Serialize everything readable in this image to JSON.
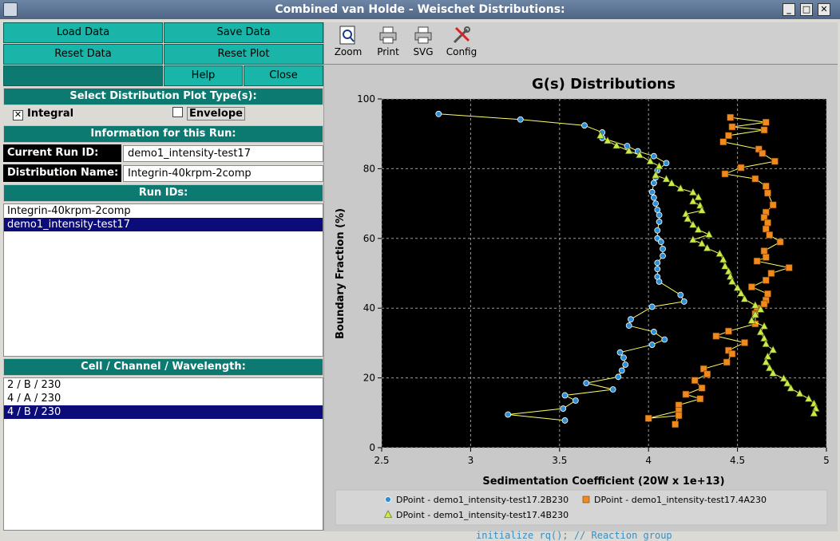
{
  "window": {
    "title": "Combined van Holde - Weischet Distributions:"
  },
  "buttons": {
    "load_data": "Load Data",
    "save_data": "Save Data",
    "reset_data": "Reset Data",
    "reset_plot": "Reset Plot",
    "help": "Help",
    "close": "Close"
  },
  "plot_type": {
    "heading": "Select Distribution Plot Type(s):",
    "integral_label": "Integral",
    "integral_checked": true,
    "envelope_label": "Envelope",
    "envelope_checked": false
  },
  "run_info": {
    "heading": "Information for this Run:",
    "current_run_label": "Current Run ID:",
    "current_run_value": "demo1_intensity-test17",
    "dist_name_label": "Distribution Name:",
    "dist_name_value": "Integrin-40krpm-2comp"
  },
  "run_ids": {
    "heading": "Run IDs:",
    "items": [
      "Integrin-40krpm-2comp",
      "demo1_intensity-test17"
    ],
    "selected": 1
  },
  "cells": {
    "heading": "Cell / Channel / Wavelength:",
    "items": [
      "2 / B / 230",
      "4 / A / 230",
      "4 / B / 230"
    ],
    "selected": 2
  },
  "toolbar": {
    "zoom": "Zoom",
    "print": "Print",
    "svg": "SVG",
    "config": "Config"
  },
  "terminal_text": "initialize rq(); // Reaction group",
  "colors": {
    "teal": "#18b5a8",
    "dark_teal": "#0d7a72",
    "selection": "#0b0b7a",
    "plot_bg": "#000000"
  },
  "chart_data": {
    "type": "scatter",
    "title": "G(s) Distributions",
    "xlabel": "Sedimentation Coefficient (20W x 1e+13)",
    "ylabel": "Boundary Fraction (%)",
    "xlim": [
      2.5,
      5.0
    ],
    "ylim": [
      0,
      100
    ],
    "xticks": [
      "2.5",
      "3",
      "3.5",
      "4",
      "4.5",
      "5"
    ],
    "yticks": [
      "0",
      "20",
      "40",
      "60",
      "80",
      "100"
    ],
    "grid": true,
    "legend_position": "bottom",
    "series": [
      {
        "name": "DPoint - demo1_intensity-test17.2B230",
        "color": "#2b8fd8",
        "marker": "circle",
        "x": [
          2.82,
          3.28,
          3.64,
          3.74,
          3.74,
          3.88,
          3.94,
          4.03,
          4.1,
          4.05,
          4.04,
          4.03,
          4.02,
          4.03,
          4.04,
          4.05,
          4.06,
          4.06,
          4.05,
          4.05,
          4.07,
          4.08,
          4.08,
          4.05,
          4.05,
          4.05,
          4.06,
          4.18,
          4.2,
          4.02,
          3.9,
          3.89,
          4.03,
          4.09,
          4.02,
          3.84,
          3.86,
          3.87,
          3.85,
          3.83,
          3.65,
          3.8,
          3.53,
          3.59,
          3.52,
          3.21,
          3.53
        ],
        "y": [
          95.7,
          94.1,
          92.4,
          90.4,
          88.8,
          86.5,
          85.0,
          83.6,
          81.6,
          79.5,
          77.5,
          75.9,
          73.3,
          71.7,
          70.0,
          68.2,
          66.7,
          64.8,
          62.3,
          60.0,
          59.0,
          57.0,
          55.0,
          53.0,
          51.2,
          49.0,
          47.6,
          43.8,
          41.9,
          40.4,
          36.8,
          35.0,
          33.2,
          31.0,
          29.5,
          27.3,
          25.8,
          23.8,
          22.1,
          20.3,
          18.5,
          16.7,
          15.0,
          13.5,
          11.2,
          9.5,
          7.8
        ]
      },
      {
        "name": "DPoint - demo1_intensity-test17.4A230",
        "color": "#f08a1c",
        "marker": "square",
        "x": [
          4.46,
          4.66,
          4.47,
          4.65,
          4.45,
          4.42,
          4.62,
          4.64,
          4.71,
          4.52,
          4.43,
          4.6,
          4.66,
          4.67,
          4.7,
          4.66,
          4.65,
          4.67,
          4.66,
          4.68,
          4.74,
          4.65,
          4.66,
          4.61,
          4.79,
          4.69,
          4.66,
          4.58,
          4.67,
          4.66,
          4.65,
          4.61,
          4.6,
          4.6,
          4.45,
          4.38,
          4.54,
          4.45,
          4.47,
          4.44,
          4.31,
          4.33,
          4.26,
          4.3,
          4.21,
          4.29,
          4.17,
          4.17,
          4.0,
          4.17,
          4.15
        ],
        "y": [
          94.7,
          93.3,
          92.0,
          91.1,
          89.5,
          87.7,
          85.6,
          84.4,
          82.1,
          80.3,
          78.5,
          77.1,
          75.0,
          73.0,
          69.6,
          67.5,
          66.0,
          64.5,
          62.7,
          61.0,
          59.0,
          56.4,
          54.6,
          53.5,
          51.6,
          50.0,
          48.0,
          46.1,
          44.1,
          42.3,
          41.2,
          40.0,
          38.4,
          35.5,
          33.4,
          32.0,
          30.1,
          27.9,
          26.9,
          24.5,
          22.6,
          21.1,
          19.3,
          17.1,
          15.3,
          14.0,
          12.2,
          10.6,
          8.4,
          9.2,
          6.7
        ]
      },
      {
        "name": "DPoint - demo1_intensity-test17.4B230",
        "color": "#c8ea4a",
        "marker": "triangle",
        "x": [
          3.73,
          3.77,
          3.82,
          3.89,
          3.95,
          4.01,
          4.06,
          4.04,
          4.1,
          4.13,
          4.18,
          4.25,
          4.28,
          4.25,
          4.29,
          4.3,
          4.21,
          4.22,
          4.25,
          4.28,
          4.34,
          4.25,
          4.3,
          4.33,
          4.4,
          4.42,
          4.43,
          4.45,
          4.46,
          4.47,
          4.5,
          4.52,
          4.54,
          4.6,
          4.63,
          4.6,
          4.58,
          4.65,
          4.63,
          4.65,
          4.66,
          4.7,
          4.67,
          4.66,
          4.68,
          4.7,
          4.76,
          4.78,
          4.8,
          4.85,
          4.9,
          4.93,
          4.94,
          4.93
        ],
        "y": [
          89.5,
          88.0,
          86.6,
          85.1,
          83.9,
          82.1,
          80.7,
          78.1,
          77.0,
          75.8,
          74.3,
          73.2,
          71.8,
          70.6,
          69.4,
          68.0,
          67.0,
          65.6,
          63.9,
          62.5,
          61.1,
          59.6,
          58.5,
          57.2,
          55.6,
          53.9,
          52.0,
          50.5,
          49.0,
          47.6,
          45.8,
          44.2,
          42.6,
          40.8,
          39.6,
          38.1,
          36.4,
          34.8,
          33.1,
          31.3,
          29.7,
          28.0,
          26.1,
          24.5,
          22.8,
          21.3,
          19.8,
          18.4,
          17.0,
          15.5,
          14.0,
          12.6,
          11.2,
          9.8
        ]
      }
    ]
  }
}
